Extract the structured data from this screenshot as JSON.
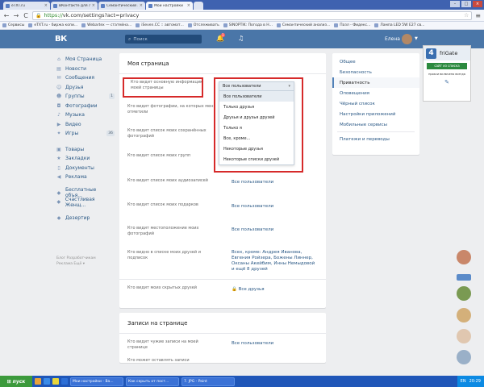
{
  "browser": {
    "tabs": [
      {
        "title": "eTXT.ru",
        "active": false
      },
      {
        "title": "ВКонтакте для любознательных",
        "active": false
      },
      {
        "title": "Семантический анализ текста",
        "active": false
      },
      {
        "title": "Мои настройки",
        "active": true
      },
      {
        "title": "",
        "active": false
      }
    ],
    "tab_close": "×",
    "window_controls": {
      "minimize": "–",
      "maximize": "□",
      "close": "×"
    },
    "nav": {
      "back": "←",
      "forward": "→",
      "reload": "C"
    },
    "url_scheme": "https://",
    "url_rest": "vk.com/settings?act=privacy",
    "bookmarks": [
      "Сервисы",
      "eTXT.ru - биржа копи...",
      "Webartex — статейна...",
      "iSeven.CC :: автомат...",
      "Отслеживать",
      "SINOPTIK: Погода в Н...",
      "Семантический анализ...",
      "Пазл - Фидекс...",
      "Лампа LED 5W E27 св..."
    ]
  },
  "vk": {
    "logo": "ВК",
    "search_placeholder": "Поиск",
    "notif_count": "1",
    "user_name": "Елена",
    "left_menu": [
      {
        "label": "Моя Страница",
        "icon": "house-icon"
      },
      {
        "label": "Новости",
        "icon": "news-icon"
      },
      {
        "label": "Сообщения",
        "icon": "message-icon"
      },
      {
        "label": "Друзья",
        "icon": "friends-icon"
      },
      {
        "label": "Группы",
        "icon": "groups-icon",
        "count": "1"
      },
      {
        "label": "Фотографии",
        "icon": "camera-icon"
      },
      {
        "label": "Музыка",
        "icon": "music-icon"
      },
      {
        "label": "Видео",
        "icon": "video-icon"
      },
      {
        "label": "Игры",
        "icon": "game-icon",
        "count": "36"
      }
    ],
    "left_menu_2": [
      {
        "label": "Товары",
        "icon": "bag-icon"
      },
      {
        "label": "Закладки",
        "icon": "star-icon"
      },
      {
        "label": "Документы",
        "icon": "doc-icon"
      },
      {
        "label": "Реклама",
        "icon": "megaphone-icon"
      }
    ],
    "left_menu_3": [
      {
        "label": "Бесплатные объя...",
        "icon": "app-icon"
      },
      {
        "label": "Счастливая Женщ...",
        "icon": "app-icon"
      }
    ],
    "left_menu_4": [
      {
        "label": "Дезертир",
        "icon": "app-icon"
      }
    ],
    "footer_links": [
      "Блог   Разработчикам",
      "Реклама   Ещё ▾"
    ]
  },
  "privacy": {
    "section1_title": "Моя страница",
    "rows": [
      {
        "label": "Кто видит основную информацию моей страницы",
        "value": ""
      },
      {
        "label": "Кто видит фотографии, на которых меня отметили",
        "value": ""
      },
      {
        "label": "Кто видит список моих сохранённых фотографий",
        "value": ""
      },
      {
        "label": "Кто видит список моих групп",
        "value": ""
      },
      {
        "label": "Кто видит список моих аудиозаписей",
        "value": "Все пользователи"
      },
      {
        "label": "Кто видит список моих подарков",
        "value": "Все пользователи"
      },
      {
        "label": "Кто видит местоположение моих фотографий",
        "value": "Все пользователи"
      },
      {
        "label": "Кто видно в списке моих друзей и подписок",
        "value": "Всех, кроме: Андрея Иванова, Евгения Ройзера, Божены Линнер, Оксаны Акейбим, Инны Немыдовой и ещё 8 друзей"
      },
      {
        "label": "Кто видит моих скрытых друзей",
        "value": "Все друзья"
      }
    ],
    "section2_title": "Записи на странице",
    "rows2": [
      {
        "label": "Кто видит чужие записи на моей странице",
        "value": "Все пользователи"
      },
      {
        "label": "Кто может оставлять записи",
        "value": ""
      }
    ],
    "dropdown": {
      "selected": "Все пользователи",
      "options": [
        "Все пользователи",
        "Только друзья",
        "Друзья и друзья друзей",
        "Только я",
        "Все, кроме...",
        "Некоторые друзья",
        "Некоторые списки друзей"
      ]
    }
  },
  "right_menu": {
    "items": [
      "Общее",
      "Безопасность",
      "Приватность",
      "Оповещения",
      "Чёрный список",
      "Настройки приложений",
      "Мобильные сервисы",
      "Платежи и переводы"
    ],
    "active": "Приватность"
  },
  "frigate": {
    "name": "friGate",
    "button": "сайт из списка",
    "text": "прокси включено всегда"
  },
  "taskbar": {
    "start": "пуск",
    "tasks": [
      "Мои настройки - Ва...",
      "Как скрыть от пост...",
      "7. JPG - Paint"
    ],
    "lang": "EN",
    "time": "20:29"
  }
}
